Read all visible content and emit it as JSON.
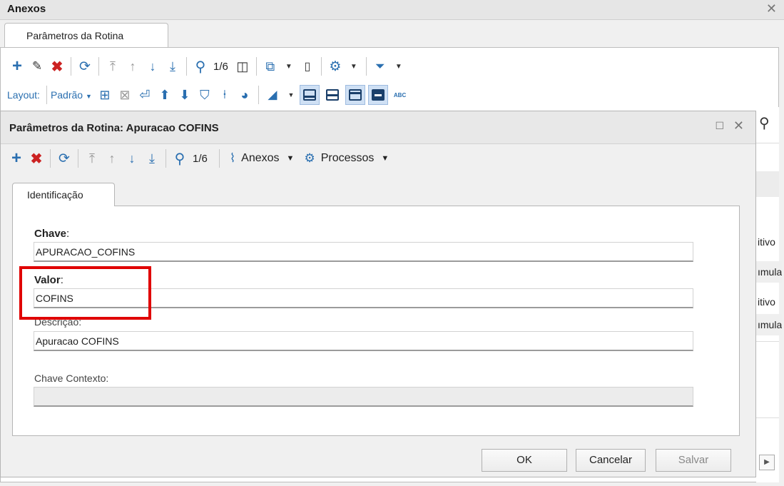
{
  "outer": {
    "title": "Anexos",
    "tab": "Parâmetros da Rotina",
    "counter": "1/6",
    "layout_label": "Layout:",
    "layout_value": "Padrão",
    "abc_label": "ABC"
  },
  "dialog": {
    "title": "Parâmetros da Rotina: Apuracao COFINS",
    "counter": "1/6",
    "menu_anexos": "Anexos",
    "menu_processos": "Processos",
    "tab": "Identificação",
    "fields": {
      "chave_label": "Chave",
      "chave_value": "APURACAO_COFINS",
      "valor_label": "Valor",
      "valor_value": "COFINS",
      "descricao_label": "Descrição:",
      "descricao_value": "Apuracao COFINS",
      "contexto_label": "Chave Contexto:",
      "contexto_value": ""
    },
    "buttons": {
      "ok": "OK",
      "cancel": "Cancelar",
      "save": "Salvar"
    }
  },
  "background_list": {
    "rows": [
      "itivo",
      "ımula",
      "itivo",
      "ımula"
    ]
  },
  "colors": {
    "accent": "#2a6fb0",
    "delete": "#cc2222",
    "highlight_box": "#e00000",
    "toggle_active_bg": "#cfe0f4"
  }
}
